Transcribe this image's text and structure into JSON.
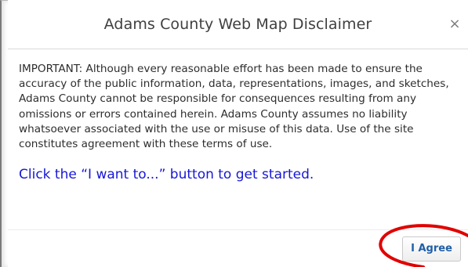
{
  "dialog": {
    "title": "Adams County Web Map Disclaimer",
    "close_icon": "close-icon",
    "close_glyph": "×",
    "disclaimer_text": "IMPORTANT: Although every reasonable effort has been made to ensure the accuracy of the public information, data, representations, images, and sketches, Adams County cannot be responsible for consequences resulting from any omissions or errors contained herein. Adams County assumes no liability whatsoever associated with the use or misuse of this data. Use of the site constitutes agreement with these terms of use.",
    "call_to_action": "Click the “I want to...” button to get started.",
    "agree_label": "I Agree"
  },
  "colors": {
    "call_to_action": "#1717d6",
    "agree_text": "#1f5fa8",
    "highlight_ellipse": "#e00000"
  }
}
